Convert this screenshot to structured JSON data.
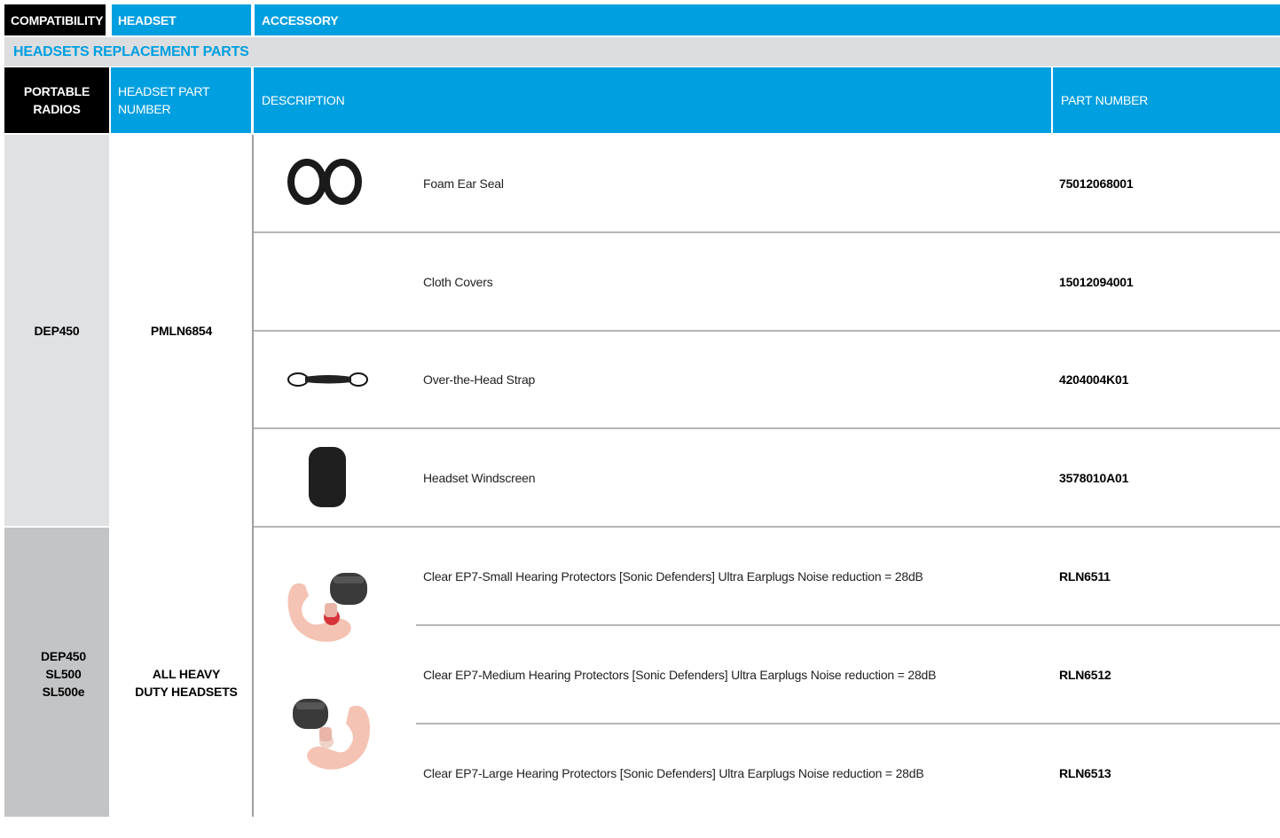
{
  "tabs": {
    "compatibility": "COMPATIBILITY",
    "headset": "HEADSET",
    "accessory": "ACCESSORY"
  },
  "section_title": "HEADSETS REPLACEMENT PARTS",
  "columns": {
    "portable_radios": "PORTABLE RADIOS",
    "headset_part_number": "HEADSET PART NUMBER",
    "description": "DESCRIPTION",
    "part_number": "PART NUMBER"
  },
  "groups": [
    {
      "radios": "DEP450",
      "headset": "PMLN6854",
      "items": [
        {
          "description": "Foam Ear Seal",
          "part_number": "75012068001",
          "icon": "ear-seal-icon"
        },
        {
          "description": "Cloth Covers",
          "part_number": "15012094001",
          "icon": ""
        },
        {
          "description": "Over-the-Head Strap",
          "part_number": "4204004K01",
          "icon": "strap-icon"
        },
        {
          "description": "Headset Windscreen",
          "part_number": "3578010A01",
          "icon": "windscreen-icon"
        }
      ]
    },
    {
      "radios": "DEP450\nSL500\nSL500e",
      "headset": "ALL HEAVY\nDUTY HEADSETS",
      "items": [
        {
          "description": "Clear EP7-Small Hearing Protectors [Sonic Defenders] Ultra Earplugs Noise reduction = 28dB",
          "part_number": "RLN6511"
        },
        {
          "description": "Clear EP7-Medium Hearing Protectors [Sonic Defenders] Ultra Earplugs Noise reduction = 28dB",
          "part_number": "RLN6512"
        },
        {
          "description": "Clear EP7-Large Hearing Protectors [Sonic Defenders] Ultra Earplugs Noise reduction = 28dB",
          "part_number": "RLN6513"
        }
      ]
    }
  ],
  "colors": {
    "accent_blue": "#009fdf",
    "black": "#000000",
    "section_grey": "#dcdddf"
  }
}
